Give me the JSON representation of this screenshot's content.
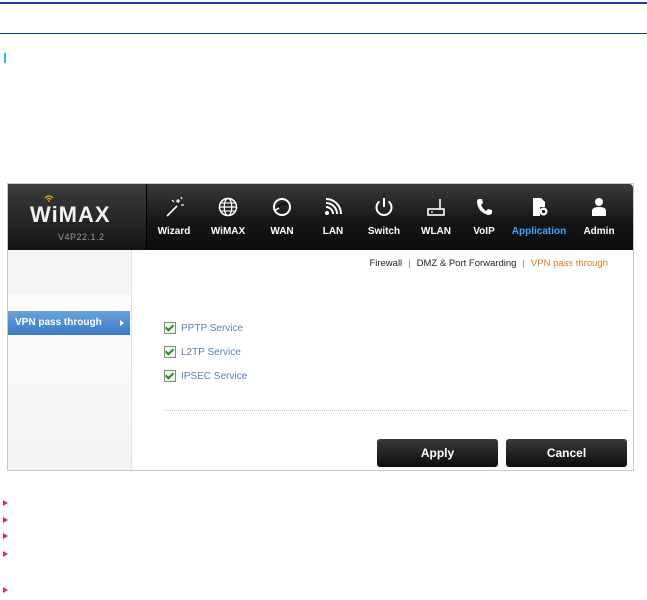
{
  "brand": {
    "logo_text": "WiMAX",
    "version": "V4P22.1.2"
  },
  "nav": {
    "items": [
      {
        "label": "Wizard",
        "icon": "wand-icon"
      },
      {
        "label": "WiMAX",
        "icon": "globe-icon"
      },
      {
        "label": "WAN",
        "icon": "globe-swirl-icon"
      },
      {
        "label": "LAN",
        "icon": "signal-icon"
      },
      {
        "label": "Switch",
        "icon": "power-icon"
      },
      {
        "label": "WLAN",
        "icon": "router-icon"
      },
      {
        "label": "VoIP",
        "icon": "phone-icon"
      },
      {
        "label": "Application",
        "icon": "app-gear-icon"
      },
      {
        "label": "Admin",
        "icon": "user-icon"
      }
    ],
    "active": "Application"
  },
  "subnav": {
    "firewall": "Firewall",
    "sep1": "|",
    "dmz": "DMZ & Port Forwarding",
    "sep2": "|",
    "vpn": "VPN pass through"
  },
  "sidebar": {
    "items": [
      {
        "label": "VPN pass through"
      }
    ]
  },
  "options": [
    {
      "label": "PPTP Service",
      "checked": true
    },
    {
      "label": "L2TP Service",
      "checked": true
    },
    {
      "label": "IPSEC Service",
      "checked": true
    }
  ],
  "buttons": {
    "apply": "Apply",
    "cancel": "Cancel"
  },
  "colors": {
    "accent": "#3ea6ff",
    "subnav_active": "#e07a1f",
    "sidebar_active": "#4a86cf",
    "bullet": "#e2247a",
    "rule": "#1b3f99"
  }
}
